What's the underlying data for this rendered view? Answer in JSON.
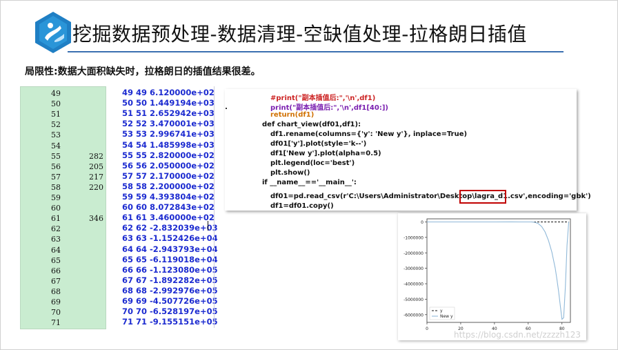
{
  "header": {
    "title": "挖掘数据预处理-数据清理-空缺值处理-拉格朗日插值",
    "subtitle": "局限性:数据大面积缺失时，拉格朗日的插值结果很差。"
  },
  "green_table": {
    "rows": [
      {
        "idx": "49",
        "val": ""
      },
      {
        "idx": "50",
        "val": ""
      },
      {
        "idx": "51",
        "val": ""
      },
      {
        "idx": "52",
        "val": ""
      },
      {
        "idx": "53",
        "val": ""
      },
      {
        "idx": "54",
        "val": ""
      },
      {
        "idx": "55",
        "val": "282"
      },
      {
        "idx": "56",
        "val": "205"
      },
      {
        "idx": "57",
        "val": "217"
      },
      {
        "idx": "58",
        "val": "220"
      },
      {
        "idx": "59",
        "val": ""
      },
      {
        "idx": "60",
        "val": ""
      },
      {
        "idx": "61",
        "val": "346"
      },
      {
        "idx": "62",
        "val": ""
      },
      {
        "idx": "63",
        "val": ""
      },
      {
        "idx": "64",
        "val": ""
      },
      {
        "idx": "65",
        "val": ""
      },
      {
        "idx": "66",
        "val": ""
      },
      {
        "idx": "67",
        "val": ""
      },
      {
        "idx": "68",
        "val": ""
      },
      {
        "idx": "69",
        "val": ""
      },
      {
        "idx": "70",
        "val": ""
      },
      {
        "idx": "71",
        "val": ""
      }
    ]
  },
  "console": {
    "rows": [
      "49 49  6.120000e+02",
      "50 50  1.449194e+03",
      "51 51  2.652942e+03",
      "52 52  3.470001e+03",
      "53 53  2.996741e+03",
      "54 54  1.485998e+03",
      "55 55  2.820000e+02",
      "56 56  2.050000e+02",
      "57 57  2.170000e+02",
      "58 58  2.200000e+02",
      "59 59  4.393804e+02",
      "60 60  8.072843e+02",
      "61 61  3.460000e+02",
      "62 62 -2.832039e+03",
      "63 63 -1.152426e+04",
      "64 64 -2.943793e+04",
      "65 65 -6.119018e+04",
      "66 66 -1.123080e+05",
      "67 67 -1.892282e+05",
      "68 68 -2.992976e+05",
      "69 69 -4.507726e+05",
      "70 70 -6.528197e+05",
      "71 71 -9.155151e+05"
    ]
  },
  "code": {
    "lines": [
      "#print(\"副本插值后:\",'\\n',df1)",
      "print(\"副本插值后:\",'\\n',df1[40:])",
      "return(df1)",
      "def chart_view(df01,df1):",
      "df1.rename(columns={'y': 'New y'}, inplace=True)",
      "df01['y'].plot(style='k--')",
      "df1['New y'].plot(alpha=0.5)",
      "plt.legend(loc='best')",
      "plt.show()",
      "if __name__=='__main__':",
      "",
      "df01=pd.read_csv(r'C:\\Users\\Administrator\\Desktop\\lagra_d1.csv',encoding='gbk')",
      "df1=df01.copy()"
    ]
  },
  "chart_data": {
    "type": "line",
    "xlim": [
      0,
      85
    ],
    "ylim": [
      -6500000,
      200000
    ],
    "x_ticks": [
      0,
      20,
      40,
      60,
      80
    ],
    "y_ticks": [
      0,
      -1000000,
      -2000000,
      -3000000,
      -4000000,
      -5000000,
      -6000000
    ],
    "y_tick_labels": [
      "0",
      "-1000000",
      "-2000000",
      "-3000000",
      "-4000000",
      "-5000000",
      "-6000000"
    ],
    "x_tick_labels": [
      "0",
      "20",
      "40",
      "60",
      "80"
    ],
    "legend": [
      "y",
      "New y"
    ],
    "legend_position": "bottom-left",
    "series": [
      {
        "name": "y",
        "style": "k--",
        "x": [
          0,
          2,
          4,
          6,
          8,
          10,
          12,
          14,
          16,
          18,
          20,
          22,
          24,
          26,
          28,
          30,
          32,
          34,
          36,
          38,
          40,
          42,
          44,
          46,
          48,
          50,
          52,
          54,
          56,
          58,
          60,
          62,
          64,
          66,
          68,
          70,
          72,
          74,
          76,
          78,
          80,
          82,
          84
        ],
        "y": [
          0,
          0,
          0,
          0,
          0,
          0,
          0,
          0,
          0,
          0,
          0,
          0,
          0,
          0,
          0,
          0,
          0,
          0,
          0,
          0,
          0,
          0,
          0,
          0,
          0,
          0,
          0,
          0,
          0,
          0,
          0,
          0,
          0,
          0,
          0,
          0,
          0,
          0,
          0,
          0,
          0,
          0,
          0
        ]
      },
      {
        "name": "New y",
        "color": "#8fb8d8",
        "x": [
          0,
          10,
          20,
          30,
          40,
          50,
          55,
          60,
          62,
          64,
          66,
          68,
          70,
          72,
          74,
          76,
          77,
          78,
          79,
          80,
          81,
          82,
          83,
          84
        ],
        "y": [
          0,
          0,
          0,
          0,
          0,
          2000,
          300,
          800,
          -3000,
          -30000,
          -110000,
          -300000,
          -650000,
          -1200000,
          -1950000,
          -3000000,
          -3700000,
          -4500000,
          -5400000,
          -6300000,
          -6200000,
          -4200000,
          -1500000,
          0
        ]
      }
    ]
  },
  "watermark": "https://blog.csdn.net/zzzzh123"
}
